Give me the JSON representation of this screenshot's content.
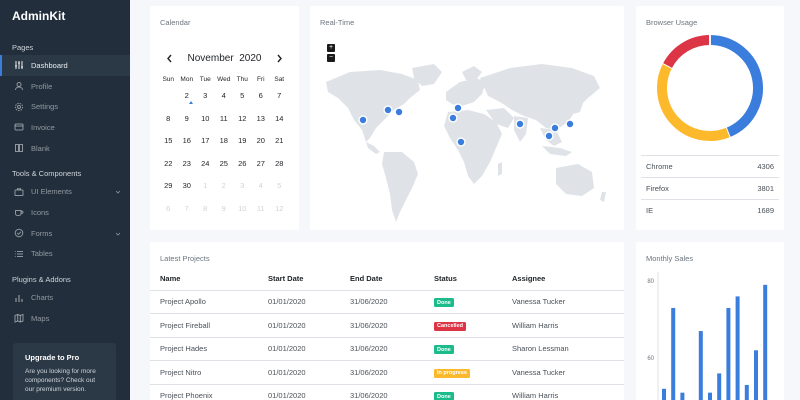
{
  "sidebar": {
    "brand": "AdminKit",
    "sections": [
      {
        "title": "Pages",
        "items": [
          {
            "label": "Dashboard",
            "icon": "sliders-icon",
            "active": true
          },
          {
            "label": "Profile",
            "icon": "user-icon"
          },
          {
            "label": "Settings",
            "icon": "settings-icon"
          },
          {
            "label": "Invoice",
            "icon": "credit-card-icon"
          },
          {
            "label": "Blank",
            "icon": "book-icon"
          }
        ]
      },
      {
        "title": "Tools & Components",
        "items": [
          {
            "label": "UI Elements",
            "icon": "briefcase-icon",
            "chevron": true
          },
          {
            "label": "Icons",
            "icon": "coffee-icon"
          },
          {
            "label": "Forms",
            "icon": "check-circle-icon",
            "chevron": true
          },
          {
            "label": "Tables",
            "icon": "list-icon"
          }
        ]
      },
      {
        "title": "Plugins & Addons",
        "items": [
          {
            "label": "Charts",
            "icon": "bar-chart-icon"
          },
          {
            "label": "Maps",
            "icon": "map-icon"
          }
        ]
      }
    ],
    "upgrade": {
      "title": "Upgrade to Pro",
      "text": "Are you looking for more components? Check out our premium version."
    }
  },
  "calendar": {
    "title": "Calendar",
    "month": "November",
    "year": "2020",
    "weekdays": [
      "Sun",
      "Mon",
      "Tue",
      "Wed",
      "Thu",
      "Fri",
      "Sat"
    ],
    "weeks": [
      [
        "",
        "2",
        "3",
        "4",
        "5",
        "6",
        "7"
      ],
      [
        "8",
        "9",
        "10",
        "11",
        "12",
        "13",
        "14"
      ],
      [
        "15",
        "16",
        "17",
        "18",
        "19",
        "20",
        "21"
      ],
      [
        "22",
        "23",
        "24",
        "25",
        "26",
        "27",
        "28"
      ],
      [
        "29",
        "30",
        "1",
        "2",
        "3",
        "4",
        "5"
      ],
      [
        "6",
        "7",
        "8",
        "9",
        "10",
        "11",
        "12"
      ]
    ],
    "today": "2"
  },
  "realtime": {
    "title": "Real-Time",
    "zoom_in": "+",
    "zoom_out": "−",
    "marker_color": "#3b7ddd"
  },
  "browser_usage": {
    "title": "Browser Usage",
    "rows": [
      {
        "name": "Chrome",
        "value": "4306"
      },
      {
        "name": "Firefox",
        "value": "3801"
      },
      {
        "name": "IE",
        "value": "1689"
      }
    ],
    "colors": {
      "Chrome": "#3b7ddd",
      "Firefox": "#fcb92c",
      "IE": "#dc3545"
    }
  },
  "projects": {
    "title": "Latest Projects",
    "columns": [
      "Name",
      "Start Date",
      "End Date",
      "Status",
      "Assignee"
    ],
    "rows": [
      {
        "name": "Project Apollo",
        "start": "01/01/2020",
        "end": "31/06/2020",
        "status": "Done",
        "status_color": "#1cbb8c",
        "assignee": "Vanessa Tucker"
      },
      {
        "name": "Project Fireball",
        "start": "01/01/2020",
        "end": "31/06/2020",
        "status": "Cancelled",
        "status_color": "#dc3545",
        "assignee": "William Harris"
      },
      {
        "name": "Project Hades",
        "start": "01/01/2020",
        "end": "31/06/2020",
        "status": "Done",
        "status_color": "#1cbb8c",
        "assignee": "Sharon Lessman"
      },
      {
        "name": "Project Nitro",
        "start": "01/01/2020",
        "end": "31/06/2020",
        "status": "In progress",
        "status_color": "#fcb92c",
        "assignee": "Vanessa Tucker"
      },
      {
        "name": "Project Phoenix",
        "start": "01/01/2020",
        "end": "31/06/2020",
        "status": "Done",
        "status_color": "#1cbb8c",
        "assignee": "William Harris"
      }
    ]
  },
  "monthly_sales": {
    "title": "Monthly Sales",
    "y_ticks": [
      "80",
      "60"
    ],
    "bar_color": "#3b7ddd"
  },
  "chart_data": {
    "type": "bar",
    "title": "Monthly Sales",
    "ylim": [
      40,
      80
    ],
    "y_ticks": [
      80,
      60
    ],
    "values": [
      52,
      73,
      51,
      49,
      67,
      51,
      56,
      73,
      76,
      53,
      62,
      79
    ],
    "note_visible_range": "bars cropped at bottom of view"
  }
}
